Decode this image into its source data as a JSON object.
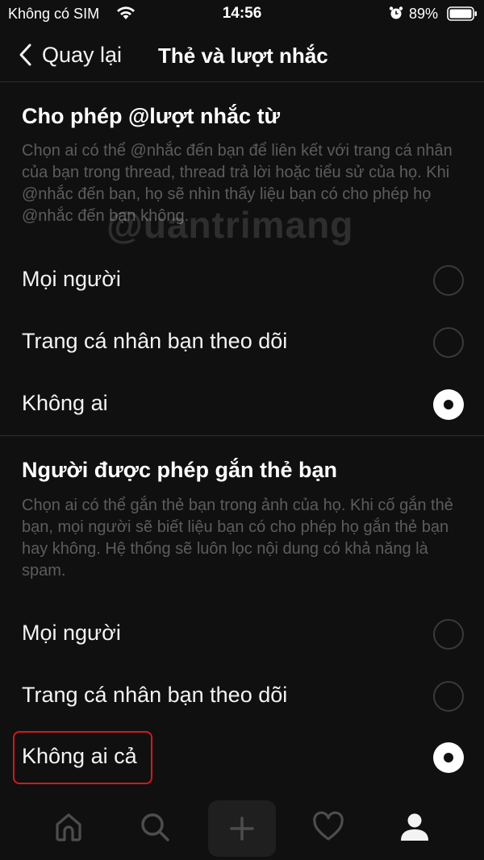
{
  "status_bar": {
    "carrier": "Không có SIM",
    "time": "14:56",
    "battery": "89%",
    "icons": [
      "wifi-icon",
      "alarm-icon",
      "battery-icon"
    ]
  },
  "nav": {
    "back_label": "Quay lại",
    "title": "Thẻ và lượt nhắc"
  },
  "mentions": {
    "title": "Cho phép @lượt nhắc từ",
    "description": "Chọn ai có thể @nhắc đến bạn để liên kết với trang cá nhân của bạn trong thread, thread trả lời hoặc tiểu sử của họ. Khi @nhắc đến bạn, họ sẽ nhìn thấy liệu bạn có cho phép họ @nhắc đến bạn không.",
    "options": [
      {
        "label": "Mọi người",
        "selected": false
      },
      {
        "label": "Trang cá nhân bạn theo dõi",
        "selected": false
      },
      {
        "label": "Không ai",
        "selected": true
      }
    ]
  },
  "tags": {
    "title": "Người được phép gắn thẻ bạn",
    "description": "Chọn ai có thể gắn thẻ bạn trong ảnh của họ. Khi cố gắn thẻ bạn, mọi người sẽ biết liệu bạn có cho phép họ gắn thẻ bạn hay không. Hệ thống sẽ luôn lọc nội dung có khả năng là spam.",
    "options": [
      {
        "label": "Mọi người",
        "selected": false
      },
      {
        "label": "Trang cá nhân bạn theo dõi",
        "selected": false
      },
      {
        "label": "Không ai cả",
        "selected": true
      }
    ]
  },
  "watermark": "@uantrimang",
  "tab_bar": {
    "tabs": [
      "home-icon",
      "search-icon",
      "plus-icon",
      "heart-icon",
      "profile-icon"
    ]
  },
  "colors": {
    "background": "#101010",
    "text": "#f3f3f3",
    "muted_text": "#5c5c5c",
    "divider": "#2e2e2e",
    "highlight": "#d11a1a"
  }
}
